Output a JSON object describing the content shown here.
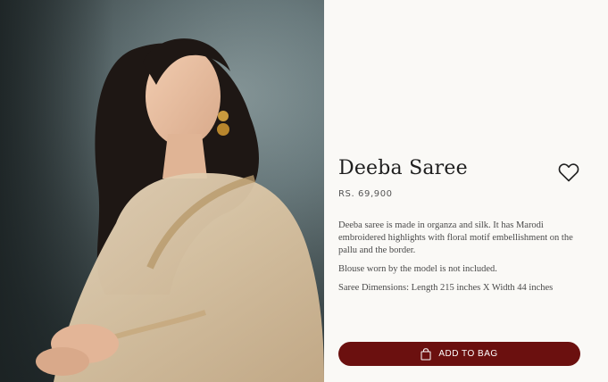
{
  "product": {
    "title": "Deeba Saree",
    "price": "RS. 69,900",
    "description": [
      "Deeba saree is made in organza and silk. It has Marodi embroidered highlights with floral motif embellishment on the pallu and the border.",
      "Blouse worn by the model is not included.",
      "Saree Dimensions: Length 215 inches X Width 44 inches"
    ],
    "add_to_bag_label": "ADD TO BAG"
  },
  "icons": {
    "wishlist": "heart-outline-icon",
    "bag": "shopping-bag-icon"
  },
  "colors": {
    "accent": "#6b100f",
    "page_background": "#faf9f6",
    "title_text": "#1f1f1f",
    "body_text": "#4a4a4a"
  }
}
